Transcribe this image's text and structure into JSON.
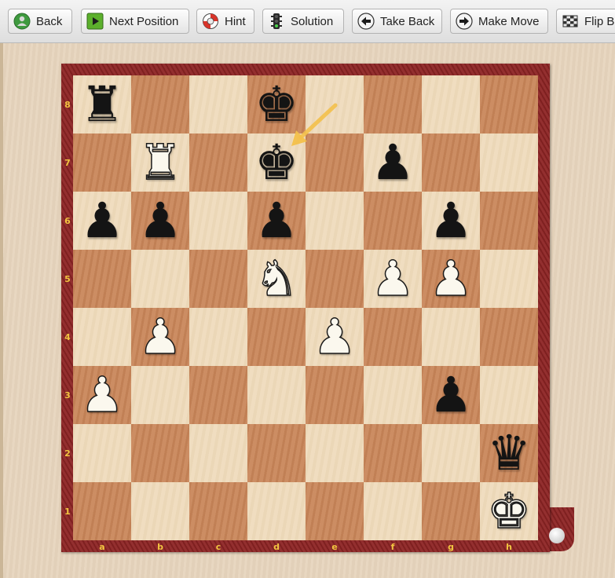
{
  "toolbar": {
    "buttons": [
      {
        "id": "back",
        "label": "Back",
        "icon": "back-icon"
      },
      {
        "id": "next",
        "label": "Next Position",
        "icon": "play-icon"
      },
      {
        "id": "hint",
        "label": "Hint",
        "icon": "lifebuoy-icon"
      },
      {
        "id": "solution",
        "label": "Solution",
        "icon": "traffic-light-icon"
      },
      {
        "id": "takeback",
        "label": "Take Back",
        "icon": "left-arrow-icon"
      },
      {
        "id": "makemove",
        "label": "Make Move",
        "icon": "right-arrow-icon"
      },
      {
        "id": "flip",
        "label": "Flip Bo",
        "icon": "flip-board-icon"
      }
    ]
  },
  "board": {
    "files": [
      "a",
      "b",
      "c",
      "d",
      "e",
      "f",
      "g",
      "h"
    ],
    "ranks": [
      "8",
      "7",
      "6",
      "5",
      "4",
      "3",
      "2",
      "1"
    ],
    "pieces": [
      {
        "square": "a8",
        "color": "black",
        "type": "rook",
        "glyph": "♜"
      },
      {
        "square": "d8",
        "color": "black",
        "type": "king",
        "glyph": "♚"
      },
      {
        "square": "b7",
        "color": "white",
        "type": "rook",
        "glyph": "♜"
      },
      {
        "square": "d7",
        "color": "black",
        "type": "king",
        "glyph": "♚"
      },
      {
        "square": "f7",
        "color": "black",
        "type": "pawn",
        "glyph": "♟"
      },
      {
        "square": "a6",
        "color": "black",
        "type": "pawn",
        "glyph": "♟"
      },
      {
        "square": "b6",
        "color": "black",
        "type": "pawn",
        "glyph": "♟"
      },
      {
        "square": "d6",
        "color": "black",
        "type": "pawn",
        "glyph": "♟"
      },
      {
        "square": "g6",
        "color": "black",
        "type": "pawn",
        "glyph": "♟"
      },
      {
        "square": "d5",
        "color": "white",
        "type": "knight",
        "glyph": "♞"
      },
      {
        "square": "f5",
        "color": "white",
        "type": "pawn",
        "glyph": "♟"
      },
      {
        "square": "g5",
        "color": "white",
        "type": "pawn",
        "glyph": "♟"
      },
      {
        "square": "b4",
        "color": "white",
        "type": "pawn",
        "glyph": "♟"
      },
      {
        "square": "e4",
        "color": "white",
        "type": "pawn",
        "glyph": "♟"
      },
      {
        "square": "a3",
        "color": "white",
        "type": "pawn",
        "glyph": "♟"
      },
      {
        "square": "g3",
        "color": "black",
        "type": "pawn",
        "glyph": "♟"
      },
      {
        "square": "h2",
        "color": "black",
        "type": "queen",
        "glyph": "♛"
      },
      {
        "square": "h1",
        "color": "white",
        "type": "king",
        "glyph": "♚"
      }
    ],
    "last_move": {
      "from": "d8",
      "to": "d7",
      "color": "#f3c04a"
    }
  }
}
